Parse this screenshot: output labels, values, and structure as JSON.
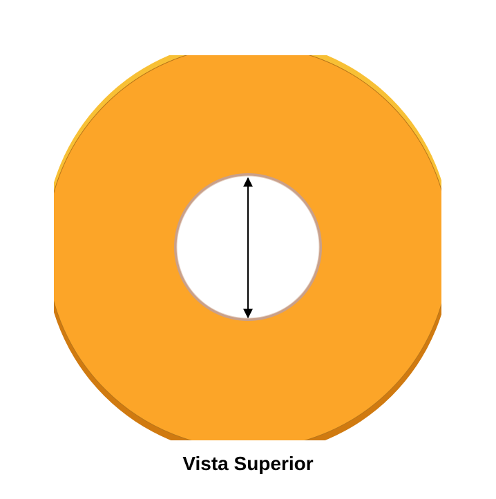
{
  "caption": "Vista Superior",
  "colors": {
    "face": "#fca528",
    "edge_dark": "#d07a10",
    "edge_light": "#f8c035",
    "hole_rim": "#c9a08a",
    "hole_fill": "#ffffff",
    "dimension_line": "#000000"
  },
  "parts": {
    "washer": "washer-disk",
    "hole": "center-hole",
    "dimension": "hole-diameter-arrow"
  }
}
